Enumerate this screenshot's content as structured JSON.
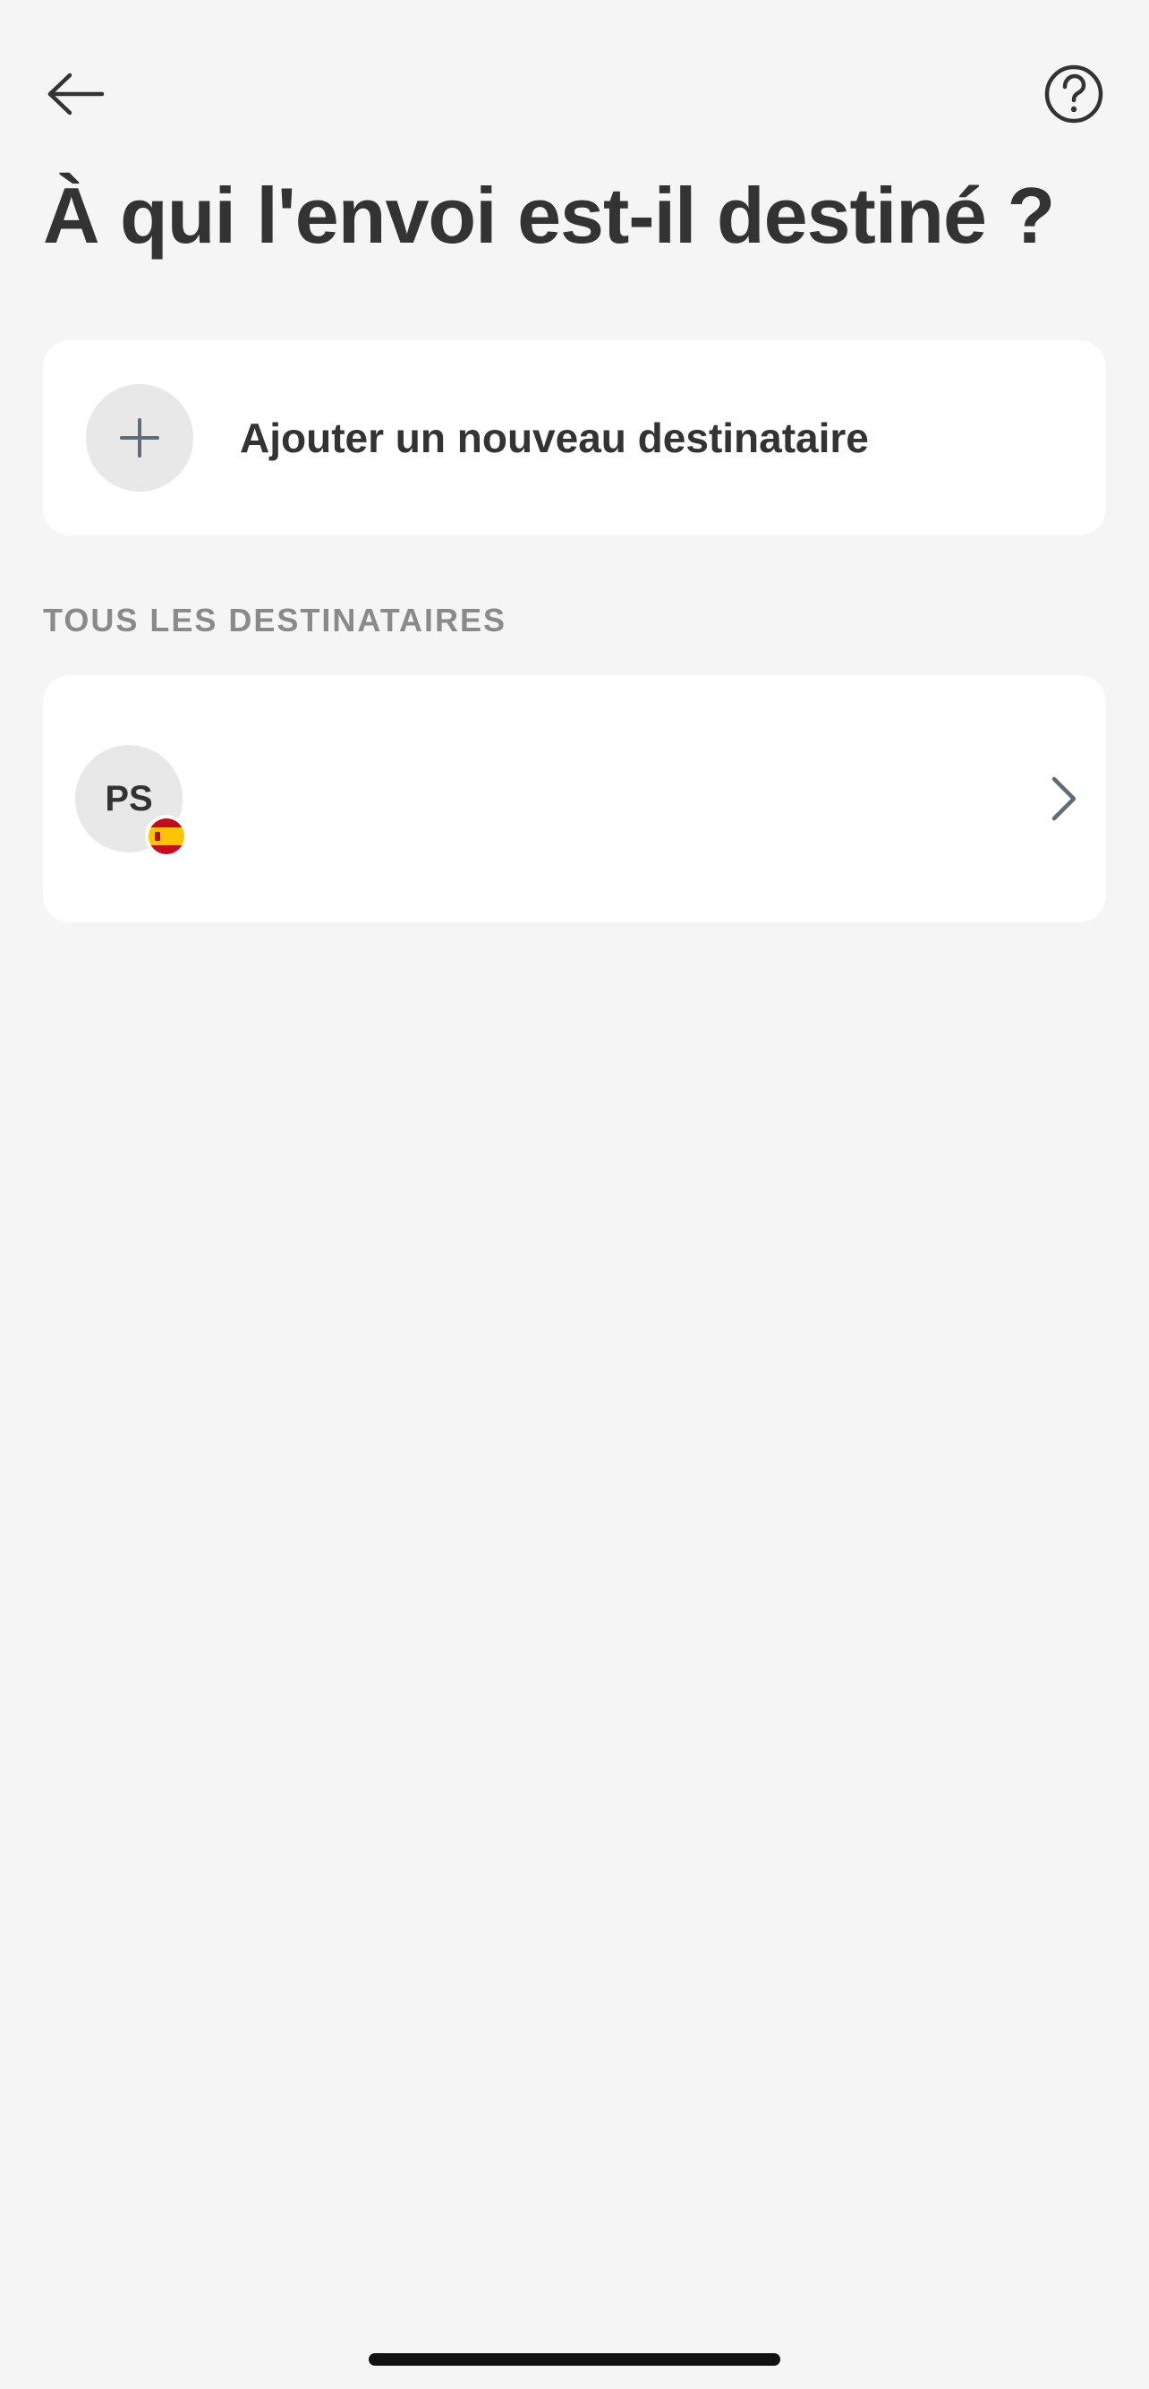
{
  "header": {
    "back_icon": "arrow-left-icon",
    "help_icon": "question-circle-icon",
    "title": "À qui l'envoi est-il destiné ?"
  },
  "add_recipient": {
    "icon": "plus-icon",
    "label": "Ajouter un nouveau destinataire"
  },
  "section": {
    "label": "TOUS LES DESTINATAIRES"
  },
  "recipients": [
    {
      "initials": "PS",
      "flag_icon": "spain-flag-icon",
      "chevron_icon": "chevron-right-icon"
    }
  ],
  "colors": {
    "background": "#f5f5f5",
    "card": "#ffffff",
    "text": "#333333",
    "muted": "#8a8a8a",
    "avatar_bg": "#e8e8e8",
    "icon_accent": "#5f6b7a"
  }
}
